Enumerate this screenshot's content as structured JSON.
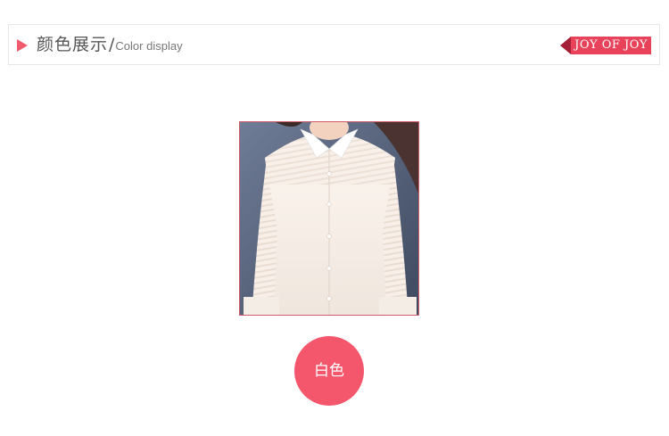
{
  "header": {
    "title_cn": "颜色展示",
    "slash": "/",
    "title_en": "Color display",
    "badge": "JOY OF JOY"
  },
  "product": {
    "image_icon": "white-blouse-photo",
    "color_name": "白色"
  },
  "colors": {
    "accent": "#f4566c",
    "badge": "#e8435a",
    "badge_tail": "#a51f36"
  }
}
